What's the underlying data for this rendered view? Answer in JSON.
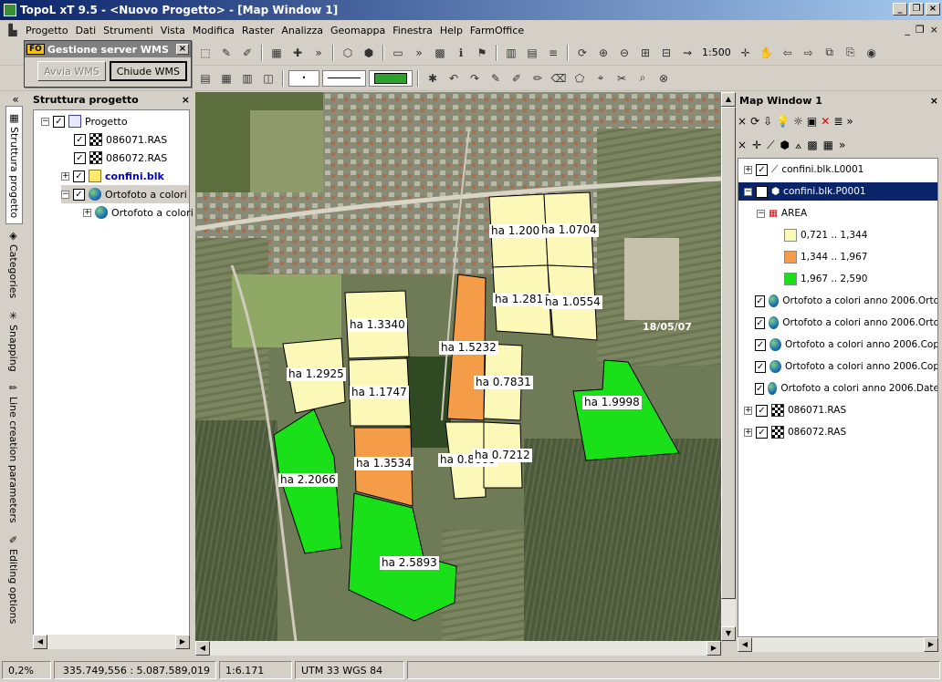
{
  "window": {
    "title": "TopoL xT 9.5 - <Nuovo Progetto> - [Map Window 1]",
    "min": "_",
    "max": "❐",
    "close": "×"
  },
  "menu": [
    "Progetto",
    "Dati",
    "Strumenti",
    "Vista",
    "Modifica",
    "Raster",
    "Analizza",
    "Geomappa",
    "Finestra",
    "Help",
    "FarmOffice"
  ],
  "toolbar": {
    "scale": "1:500"
  },
  "wms_dialog": {
    "title": "Gestione server WMS",
    "badge": "FO",
    "btn_start": "Avvia WMS",
    "btn_stop": "Chiude WMS"
  },
  "left_tabs": [
    "Struttura progetto",
    "Categories",
    "Snapping",
    "Line creation parameters",
    "Editing options"
  ],
  "project_panel": {
    "title": "Struttura progetto",
    "items": [
      {
        "label": "Progetto"
      },
      {
        "label": "086071.RAS"
      },
      {
        "label": "086072.RAS"
      },
      {
        "label": "confini.blk"
      },
      {
        "label": "Ortofoto a colori"
      },
      {
        "label": "Ortofoto a colori"
      }
    ]
  },
  "map": {
    "date": "18/05/07",
    "parcels": [
      {
        "label": "ha 1.2007",
        "value": 1.2007
      },
      {
        "label": "ha 1.0704",
        "value": 1.0704
      },
      {
        "label": "ha 1.2816",
        "value": 1.2816
      },
      {
        "label": "ha 1.0554",
        "value": 1.0554
      },
      {
        "label": "ha 1.3340",
        "value": 1.334
      },
      {
        "label": "ha 1.5232",
        "value": 1.5232
      },
      {
        "label": "ha 1.2925",
        "value": 1.2925
      },
      {
        "label": "ha 1.1747",
        "value": 1.1747
      },
      {
        "label": "ha 0.7831",
        "value": 0.7831
      },
      {
        "label": "ha 1.9998",
        "value": 1.9998
      },
      {
        "label": "ha 0.8668",
        "value": 0.8668
      },
      {
        "label": "ha 1.3534",
        "value": 1.3534
      },
      {
        "label": "ha 0.7212",
        "value": 0.7212
      },
      {
        "label": "ha 2.2066",
        "value": 2.2066
      },
      {
        "label": "ha 2.5893",
        "value": 2.5893
      }
    ]
  },
  "colors": {
    "class_low": "#fcf8b8",
    "class_mid": "#f49c48",
    "class_high": "#19e019",
    "selection": "#0a246a"
  },
  "right_panel": {
    "title": "Map Window 1",
    "layers": [
      {
        "label": "confini.blk.L0001"
      },
      {
        "label": "confini.blk.P0001"
      },
      {
        "label": "AREA"
      },
      {
        "label": "0,721 .. 1,344"
      },
      {
        "label": "1,344 .. 1,967"
      },
      {
        "label": "1,967 .. 2,590"
      },
      {
        "label": "Ortofoto a colori anno 2006.Orto"
      },
      {
        "label": "Ortofoto a colori anno 2006.Orto"
      },
      {
        "label": "Ortofoto a colori anno 2006.Cop"
      },
      {
        "label": "Ortofoto a colori anno 2006.Cop"
      },
      {
        "label": "Ortofoto a colori anno 2006.Date"
      },
      {
        "label": "086071.RAS"
      },
      {
        "label": "086072.RAS"
      }
    ]
  },
  "status": {
    "zoom": "0,2%",
    "coords": "335.749,556 : 5.087.589,019",
    "scale": "1:6.171",
    "crs": "UTM 33 WGS 84"
  }
}
